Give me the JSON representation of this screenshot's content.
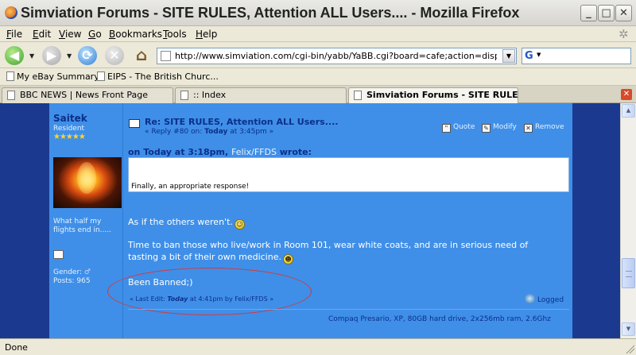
{
  "window": {
    "title": "Simviation Forums - SITE RULES, Attention ALL Users.... - Mozilla Firefox",
    "minimize_label": "_",
    "maximize_label": "□",
    "close_label": "✕"
  },
  "menu": {
    "items": [
      {
        "key": "F",
        "rest": "ile"
      },
      {
        "key": "E",
        "rest": "dit"
      },
      {
        "key": "V",
        "rest": "iew"
      },
      {
        "key": "G",
        "rest": "o"
      },
      {
        "key": "B",
        "rest": "ookmarks"
      },
      {
        "key": "T",
        "rest": "ools"
      },
      {
        "key": "H",
        "rest": "elp"
      }
    ]
  },
  "navigation": {
    "back_icon": "arrow-left-icon",
    "forward_icon": "arrow-right-icon",
    "reload_icon": "reload-icon",
    "stop_icon": "stop-icon",
    "home_icon": "home-icon",
    "url": "http://www.simviation.com/cgi-bin/yabb/YaBB.cgi?board=cafe;action=display;num=",
    "search_engine": "G"
  },
  "bookmarks": [
    "My eBay Summary",
    "EIPS - The British Churc..."
  ],
  "tabs": [
    {
      "label": "BBC NEWS | News Front Page",
      "active": false
    },
    {
      "label": ":: Index",
      "active": false
    },
    {
      "label": "Simviation Forums - SITE RULES,...",
      "active": true
    }
  ],
  "post": {
    "author": "Saitek",
    "rank": "Resident",
    "stars": "★★★★★",
    "personal_text": "What half my flights end in.....",
    "gender_label": "Gender:",
    "gender_icon": "♂",
    "posts_label": "Posts: 965",
    "title": "Re: SITE RULES, Attention ALL Users....",
    "reply_prefix": "« Reply #80 on: ",
    "reply_day": "Today",
    "reply_time": " at 3:45pm »",
    "actions": {
      "quote": "Quote",
      "modify": "Modify",
      "remove": "Remove"
    },
    "quote_header_prefix": "on Today at 3:18pm, ",
    "quote_author": "Felix/FFDS",
    "quote_header_suffix": " wrote:",
    "quote_text": "Finally, an appropriate response!",
    "line1": "As if the others weren't.",
    "line2": "Time to ban those who live/work in Room 101, wear white coats, and are in serious need of",
    "line3": "tasting a bit of their own medicine.",
    "line4": "Been Banned;)",
    "last_edit_prefix": "« Last Edit: ",
    "last_edit_day": "Today",
    "last_edit_suffix": " at 4:41pm by Felix/FFDS »",
    "logged": "Logged",
    "signature": "Compaq Presario, XP, 80GB hard drive, 2x256mb ram, 2.6Ghz"
  },
  "status": {
    "text": "Done"
  },
  "colors": {
    "post_bg": "#3f8fe8",
    "gutter": "#1b3a8f",
    "annotation_circle": "#d33a3a"
  }
}
